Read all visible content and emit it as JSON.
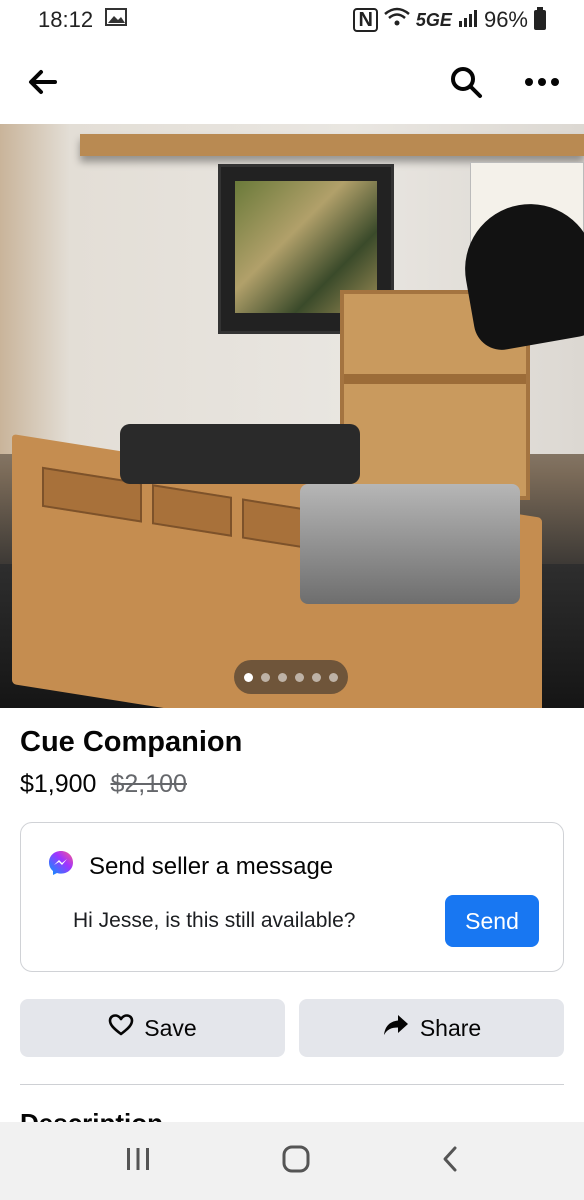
{
  "status_bar": {
    "time": "18:12",
    "nfc": "N",
    "network": "5GE",
    "battery": "96%"
  },
  "nav": {
    "back_icon": "arrow-left-icon",
    "search_icon": "search-icon",
    "more_icon": "more-horizontal-icon"
  },
  "photo": {
    "carousel_count": 6,
    "carousel_active_index": 0
  },
  "listing": {
    "title": "Cue Companion",
    "price": "$1,900",
    "original_price": "$2,100"
  },
  "message_card": {
    "heading": "Send seller a message",
    "message_value": "Hi Jesse, is this still available?",
    "send_label": "Send",
    "icon": "messenger-icon"
  },
  "actions": {
    "save_label": "Save",
    "share_label": "Share"
  },
  "description": {
    "heading": "Description"
  },
  "system_nav": {
    "recents_icon": "recents-icon",
    "home_icon": "home-icon",
    "back_icon": "chevron-left-icon"
  },
  "colors": {
    "primary_blue": "#1877f2",
    "button_gray": "#e4e6eb",
    "text": "#050505",
    "muted": "#65676b"
  }
}
